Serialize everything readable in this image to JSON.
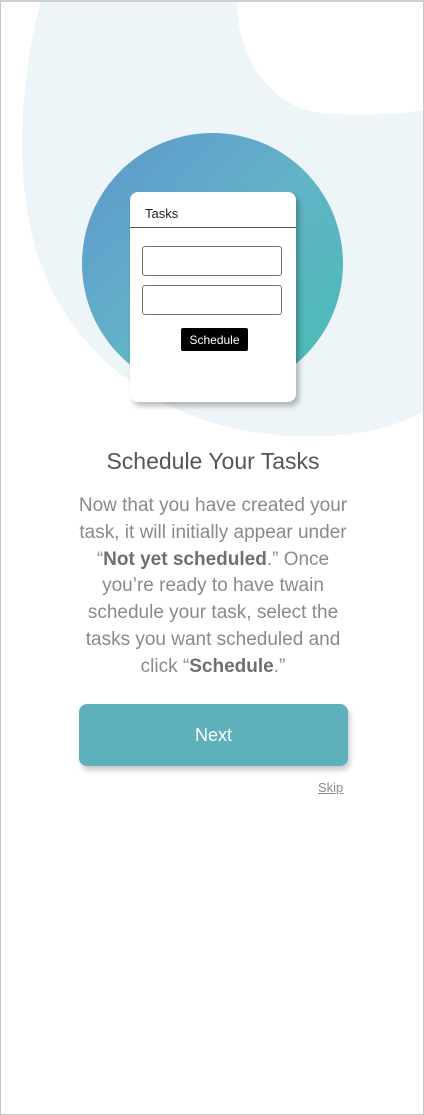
{
  "illustration": {
    "card_title": "Tasks",
    "schedule_button_label": "Schedule"
  },
  "content": {
    "heading": "Schedule Your Tasks",
    "body": {
      "t1": "Now that you have created your task, it will initially appear under “",
      "b1": "Not yet scheduled",
      "t2": ".” Once you’re ready to have twain schedule your task, select the tasks you want scheduled and click “",
      "b2": "Schedule",
      "t3": ".”"
    }
  },
  "actions": {
    "next_label": "Next",
    "skip_label": "Skip"
  },
  "colors": {
    "accent": "#5eb0bb",
    "blob": "#eef5f8",
    "heading": "#555555",
    "body_text": "#8a8a8a"
  }
}
